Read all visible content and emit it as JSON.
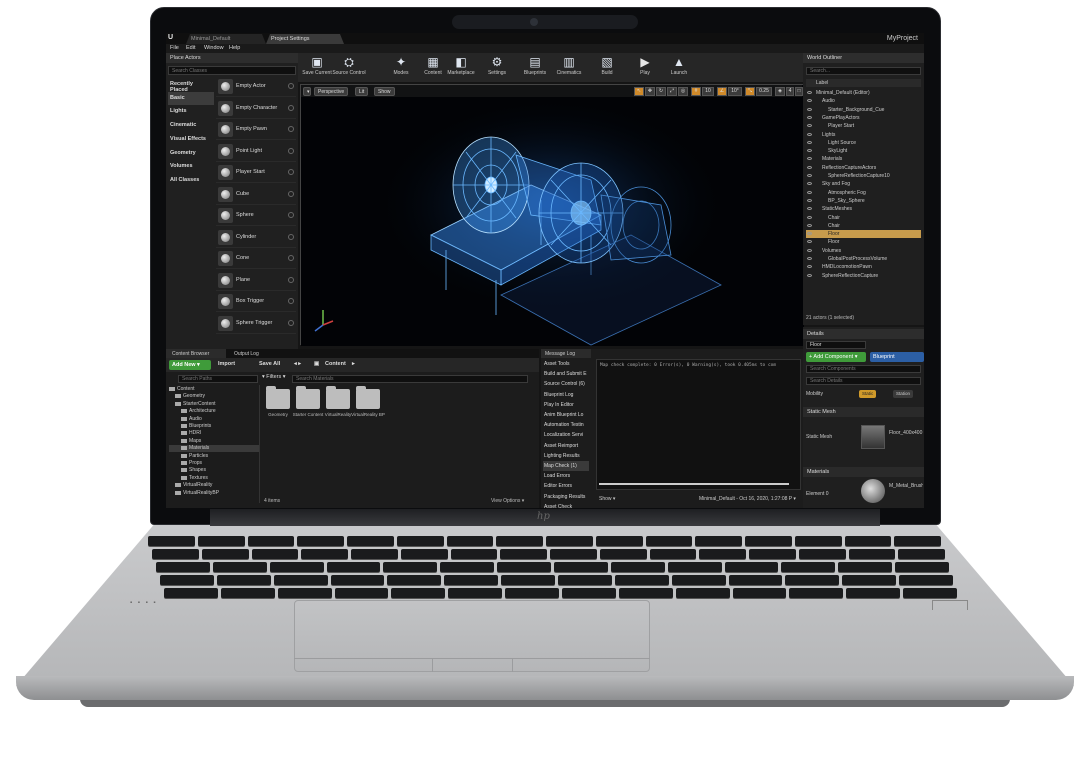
{
  "window": {
    "tabs": [
      "Minimal_Default",
      "Project Settings"
    ],
    "project_name": "MyProject",
    "menu": [
      "File",
      "Edit",
      "Window",
      "Help"
    ]
  },
  "place_actors": {
    "title": "Place Actors",
    "search_placeholder": "Search Classes",
    "categories": [
      "Recently Placed",
      "Basic",
      "Lights",
      "Cinematic",
      "Visual Effects",
      "Geometry",
      "Volumes",
      "All Classes"
    ],
    "selected_category": "Basic",
    "items": [
      "Empty Actor",
      "Empty Character",
      "Empty Pawn",
      "Point Light",
      "Player Start",
      "Cube",
      "Sphere",
      "Cylinder",
      "Cone",
      "Plane",
      "Box Trigger",
      "Sphere Trigger"
    ]
  },
  "toolbar": {
    "buttons": [
      {
        "label": "Save Current",
        "icon": "save-icon"
      },
      {
        "label": "Source Control",
        "icon": "source-control-icon"
      },
      {
        "label": "Modes",
        "icon": "modes-icon"
      },
      {
        "label": "Content",
        "icon": "content-icon"
      },
      {
        "label": "Marketplace",
        "icon": "marketplace-icon"
      },
      {
        "label": "Settings",
        "icon": "settings-icon"
      },
      {
        "label": "Blueprints",
        "icon": "blueprints-icon"
      },
      {
        "label": "Cinematics",
        "icon": "cinematics-icon"
      },
      {
        "label": "Build",
        "icon": "build-icon"
      },
      {
        "label": "Play",
        "icon": "play-icon"
      },
      {
        "label": "Launch",
        "icon": "launch-icon"
      }
    ]
  },
  "viewport": {
    "perspective": "Perspective",
    "lit": "Lit",
    "show": "Show",
    "grid_size": "10",
    "rotation_snap": "10°",
    "scale_snap": "0.25",
    "camera_speed": "4"
  },
  "world_outliner": {
    "title": "World Outliner",
    "search_placeholder": "Search...",
    "column_label": "Label",
    "rows": [
      "Minimal_Default (Editor)",
      "Audio",
      "Starter_Background_Cue",
      "GamePlayActors",
      "Player Start",
      "Lights",
      "Light Source",
      "SkyLight",
      "Materials",
      "ReflectionCaptureActors",
      "SphereReflectionCapture10",
      "Sky and Fog",
      "Atmospheric Fog",
      "BP_Sky_Sphere",
      "StaticMeshes",
      "Chair",
      "Chair",
      "Floor",
      "Floor",
      "Volumes",
      "GlobalPostProcessVolume",
      "HMDLocomotionPawn",
      "SphereReflectionCapture"
    ],
    "selected_index": 17,
    "count": "21 actors (1 selected)"
  },
  "details": {
    "title": "Details",
    "object_name": "Floor",
    "add_component": "+ Add Component ▾",
    "blueprint": "Blueprint",
    "search_components": "Search Components",
    "search_details": "Search Details",
    "mobility_label": "Mobility",
    "mobility_static": "Static",
    "mobility_stationary": "Station",
    "static_mesh_section": "Static Mesh",
    "static_mesh_label": "Static Mesh",
    "static_mesh_value": "Floor_400x400",
    "materials_section": "Materials",
    "element_label": "Element 0",
    "element_value": "M_Metal_Brushed"
  },
  "content_browser": {
    "tabs": [
      "Content Browser",
      "Output Log"
    ],
    "add_new": "Add New ▾",
    "import": "Import",
    "save_all": "Save All",
    "path": "Content",
    "search_paths": "Search Paths",
    "filters": "Filters",
    "search_assets": "Search Materials",
    "tree": [
      "Content",
      "Geometry",
      "StarterContent",
      "Architecture",
      "Audio",
      "Blueprints",
      "HDRI",
      "Maps",
      "Materials",
      "Particles",
      "Props",
      "Shapes",
      "Textures",
      "VirtualReality",
      "VirtualRealityBP"
    ],
    "selected_tree_index": 8,
    "folders": [
      "Geometry",
      "Starter Content",
      "VirtualReality",
      "VirtualReality BP"
    ],
    "item_count": "4 items",
    "view_options": "View Options ▾"
  },
  "message_log": {
    "tab": "Message Log",
    "categories": [
      "Asset Tools",
      "Build and Submit E",
      "Source Control (6)",
      "Blueprint Log",
      "Play In Editor",
      "Anim Blueprint Lo",
      "Automation Testin",
      "Localization Servi",
      "Asset Reimport",
      "Lighting Results",
      "Map Check (1)",
      "Load Errors",
      "Editor Errors",
      "Packaging Results",
      "Asset Check"
    ],
    "selected_index": 10,
    "message": "Map check complete: 0 Error(s), 0 Warning(s), took 0.405ms to com",
    "show": "Show ▾",
    "footer": "Minimal_Default - Oct 16, 2020, 1:27:08 P ▾"
  }
}
